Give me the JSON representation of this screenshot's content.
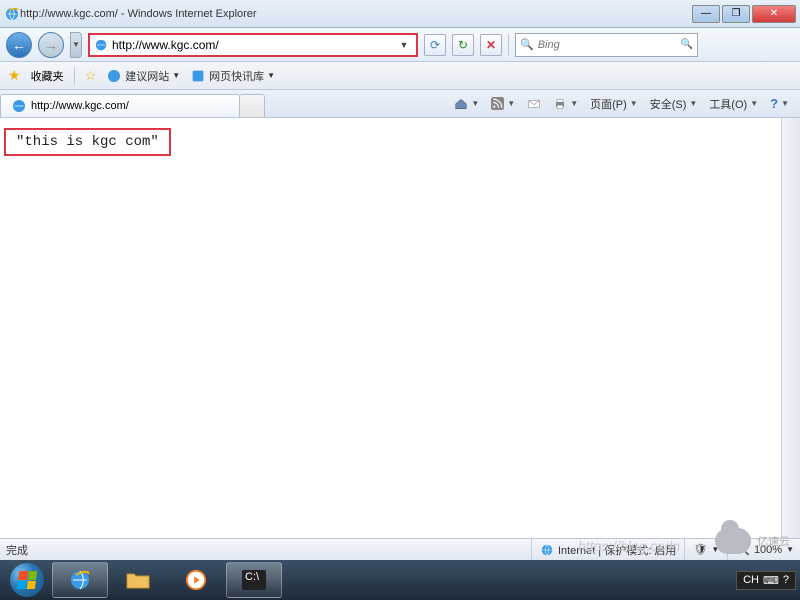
{
  "window": {
    "title": "http://www.kgc.com/ - Windows Internet Explorer"
  },
  "nav": {
    "address": "http://www.kgc.com/"
  },
  "search": {
    "placeholder": "Bing"
  },
  "bookmarks": {
    "fav_label": "收藏夹",
    "suggest_sites": "建议网站",
    "web_slice": "网页快讯库"
  },
  "tab": {
    "title": "http://www.kgc.com/"
  },
  "commandbar": {
    "page": "页面(P)",
    "safety": "安全(S)",
    "tools": "工具(O)"
  },
  "page": {
    "body_text": "\"this is kgc com\""
  },
  "status": {
    "done": "完成",
    "zone": "Internet | 保护模式: 启用",
    "zoom": "100%"
  },
  "lang": {
    "code": "CH"
  },
  "ghost_url": "https://blog.csdn",
  "watermark_text": "亿速云"
}
